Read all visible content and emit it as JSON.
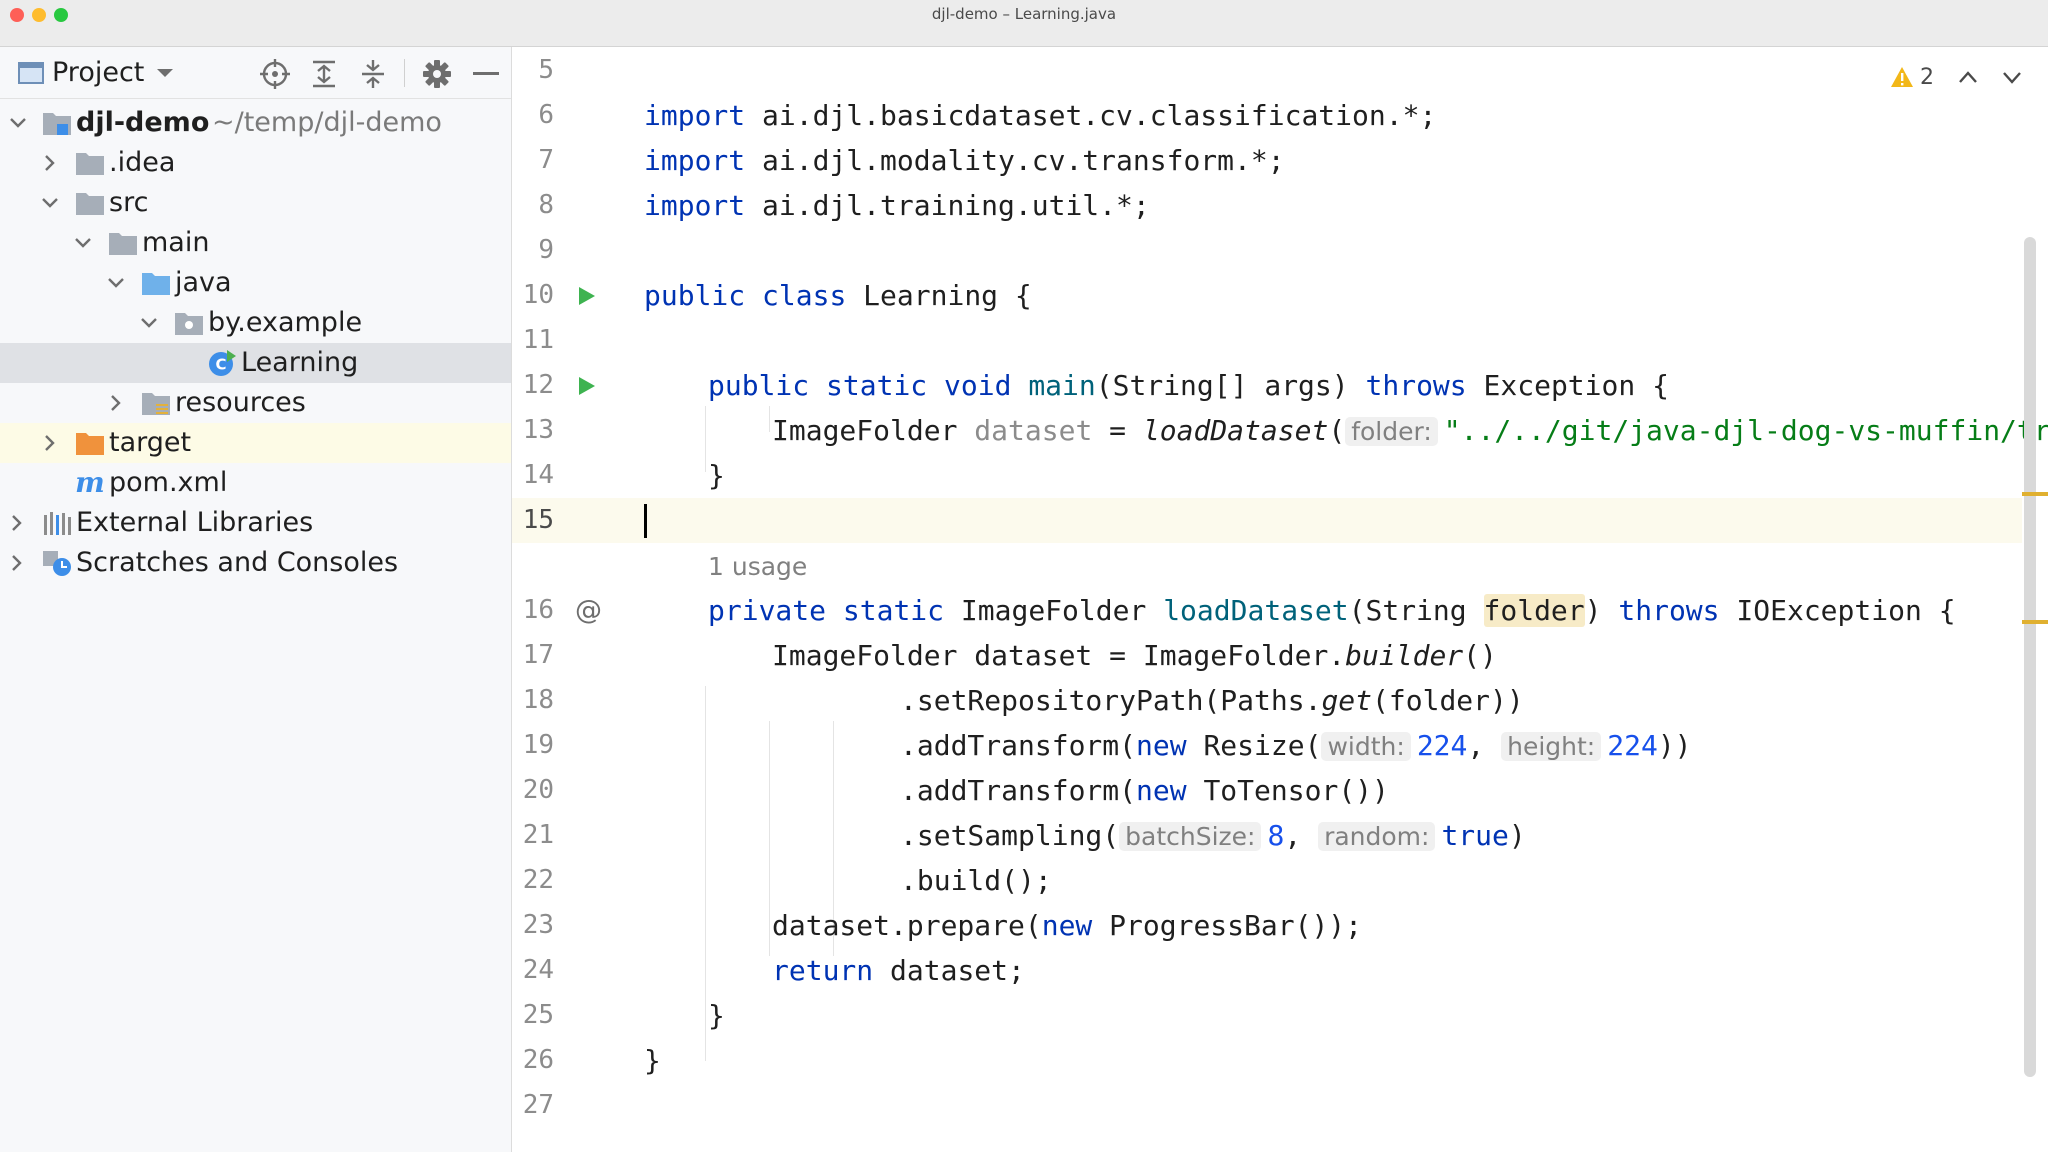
{
  "window": {
    "title": "djl-demo – Learning.java"
  },
  "sidebar": {
    "view_label": "Project",
    "tree": [
      {
        "id": "djl-demo",
        "label": "djl-demo",
        "path": "~/temp/djl-demo"
      },
      {
        "id": "idea",
        "label": ".idea"
      },
      {
        "id": "src",
        "label": "src"
      },
      {
        "id": "main",
        "label": "main"
      },
      {
        "id": "java",
        "label": "java"
      },
      {
        "id": "by-example",
        "label": "by.example"
      },
      {
        "id": "learning",
        "label": "Learning"
      },
      {
        "id": "resources",
        "label": "resources"
      },
      {
        "id": "target",
        "label": "target"
      },
      {
        "id": "pom",
        "label": "pom.xml"
      },
      {
        "id": "external-libraries",
        "label": "External Libraries"
      },
      {
        "id": "scratches",
        "label": "Scratches and Consoles"
      }
    ]
  },
  "editor": {
    "warnings_count": "2",
    "usage_hint": "1 usage",
    "line_numbers": [
      "5",
      "6",
      "7",
      "8",
      "9",
      "10",
      "11",
      "12",
      "13",
      "14",
      "15",
      "16",
      "17",
      "18",
      "19",
      "20",
      "21",
      "22",
      "23",
      "24",
      "25",
      "26",
      "27"
    ],
    "tokens": {
      "import": "import",
      "imp6": "ai.djl.basicdataset.cv.classification.*;",
      "imp7": "ai.djl.modality.cv.transform.*;",
      "imp8": "ai.djl.training.util.*;",
      "public": "public",
      "class": "class",
      "static": "static",
      "void": "void",
      "private": "private",
      "throws": "throws",
      "new": "new",
      "return": "return",
      "true": "true",
      "class_name": "Learning",
      "open_brace": "{",
      "close_brace": "}",
      "main_fn": "main",
      "main_params": "(String[] args)",
      "exception": "Exception",
      "image_folder": "ImageFolder",
      "dataset_var": "dataset",
      "equals": "=",
      "load_dataset": "loadDataset",
      "open_paren": "(",
      "close_paren": ")",
      "hint_folder": "folder:",
      "path_string": "\"../../git/java-djl-dog-vs-muffin/train",
      "string_type": "String",
      "folder_param": "folder",
      "io_exception": "IOException",
      "builder_prefix": "ImageFolder dataset = ImageFolder.",
      "builder": "builder",
      "empty_parens": "()",
      "set_repo_prefix": ".setRepositoryPath(Paths.",
      "get": "get",
      "set_repo_suffix": "(folder))",
      "add_transform": ".addTransform(",
      "resize": "Resize(",
      "hint_width": "width:",
      "val_224": "224",
      "comma": ",",
      "hint_height": "height:",
      "double_close": "))",
      "to_tensor": "ToTensor())",
      "set_sampling": ".setSampling(",
      "hint_batch": "batchSize:",
      "val_8": "8",
      "hint_random": "random:",
      "build_call": ".build();",
      "prepare_prefix": "dataset.prepare(",
      "progress_bar": "ProgressBar());",
      "return_value": "dataset;"
    }
  },
  "colors": {
    "keyword": "#0033b3",
    "method": "#00627a",
    "number": "#1750eb",
    "string": "#067d17",
    "selected_row": "#dfe1e5",
    "caret_row": "#fcfaed",
    "warning": "#f2b718"
  }
}
